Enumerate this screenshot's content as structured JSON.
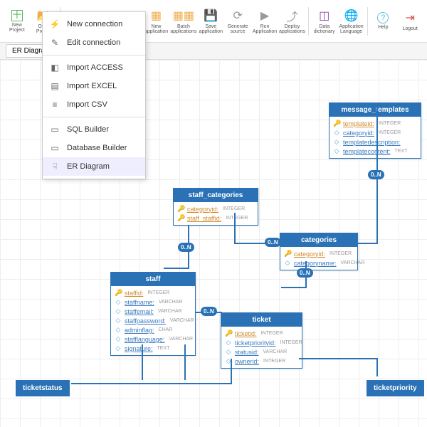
{
  "toolbar": {
    "items": [
      {
        "name": "new-project",
        "label": "New Project",
        "icon": "＋",
        "color": "#5cb85c"
      },
      {
        "name": "open-project",
        "label": "Open Project",
        "icon": "📂",
        "color": "#5bc0de"
      },
      {
        "name": "new-application",
        "label": "New application",
        "icon": "▦",
        "color": "#f0ad4e"
      },
      {
        "name": "batch-applications",
        "label": "Batch applications",
        "icon": "▦▦",
        "color": "#f0ad4e"
      },
      {
        "name": "save-application",
        "label": "Save application",
        "icon": "💾",
        "color": "#999"
      },
      {
        "name": "generate-source",
        "label": "Generate source",
        "icon": "⟳",
        "color": "#999"
      },
      {
        "name": "run-application",
        "label": "Run Application",
        "icon": "▶",
        "color": "#999"
      },
      {
        "name": "deploy-applications",
        "label": "Deploy applications",
        "icon": "⤴",
        "color": "#999"
      },
      {
        "name": "data-dictionary",
        "label": "Data dictionary",
        "icon": "◫",
        "color": "#8e44ad"
      },
      {
        "name": "application-language",
        "label": "Application Language",
        "icon": "🌐",
        "color": "#8e44ad"
      },
      {
        "name": "help",
        "label": "Help",
        "icon": "?",
        "color": "#5bc0de"
      },
      {
        "name": "logout",
        "label": "Logout",
        "icon": "⇥",
        "color": "#d9534f"
      }
    ]
  },
  "tab": {
    "label": "ER Diagram"
  },
  "dropdown": {
    "sections": [
      [
        {
          "name": "new-connection",
          "label": "New connection",
          "icon": "⚡"
        },
        {
          "name": "edit-connection",
          "label": "Edit connection",
          "icon": "✎"
        }
      ],
      [
        {
          "name": "import-access",
          "label": "Import ACCESS",
          "icon": "◧"
        },
        {
          "name": "import-excel",
          "label": "Import EXCEL",
          "icon": "▤"
        },
        {
          "name": "import-csv",
          "label": "Import CSV",
          "icon": "≡"
        }
      ],
      [
        {
          "name": "sql-builder",
          "label": "SQL Builder",
          "icon": "▭"
        },
        {
          "name": "database-builder",
          "label": "Database Builder",
          "icon": "▭"
        },
        {
          "name": "er-diagram",
          "label": "ER Diagram",
          "icon": "☟"
        }
      ]
    ]
  },
  "entities": {
    "staff_categories": {
      "title": "staff_categories",
      "fields": [
        {
          "name": "categoryid:",
          "type": "INTEGER",
          "key": true
        },
        {
          "name": "staff_staffid:",
          "type": "INTEGER",
          "key": true
        }
      ]
    },
    "categories": {
      "title": "categories",
      "fields": [
        {
          "name": "categoryid:",
          "type": "INTEGER",
          "key": true
        },
        {
          "name": "categoryname:",
          "type": "VARCHAR",
          "key": false
        }
      ]
    },
    "message_templates": {
      "title": "message_templates",
      "fields": [
        {
          "name": "templateid:",
          "type": "INTEGER",
          "key": true
        },
        {
          "name": "categoryid:",
          "type": "INTEGER",
          "key": false
        },
        {
          "name": "templatedescription:",
          "type": "",
          "key": false
        },
        {
          "name": "templatecontent:",
          "type": "TEXT",
          "key": false
        }
      ]
    },
    "staff": {
      "title": "staff",
      "fields": [
        {
          "name": "staffid:",
          "type": "INTEGER",
          "key": true
        },
        {
          "name": "staffname:",
          "type": "VARCHAR",
          "key": false
        },
        {
          "name": "staffemail:",
          "type": "VARCHAR",
          "key": false
        },
        {
          "name": "staffpassword:",
          "type": "VARCHAR",
          "key": false
        },
        {
          "name": "adminflag:",
          "type": "CHAR",
          "key": false
        },
        {
          "name": "stafflanguage:",
          "type": "VARCHAR",
          "key": false
        },
        {
          "name": "signature:",
          "type": "TEXT",
          "key": false
        }
      ]
    },
    "ticket": {
      "title": "ticket",
      "fields": [
        {
          "name": "ticketid:",
          "type": "INTEGER",
          "key": true
        },
        {
          "name": "ticketpriorityid:",
          "type": "INTEGER",
          "key": false
        },
        {
          "name": "statusid:",
          "type": "VARCHAR",
          "key": false
        },
        {
          "name": "ownerid:",
          "type": "INTEGER",
          "key": false
        }
      ]
    }
  },
  "tags": {
    "ticketstatus": "ticketstatus",
    "ticketpriority": "ticketpriority"
  },
  "cardinality": "0..N"
}
